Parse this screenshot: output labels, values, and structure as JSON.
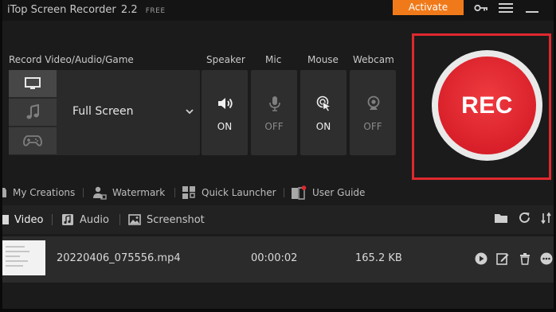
{
  "app": {
    "name": "iTop Screen Recorder",
    "version": "2.2",
    "edition": "FREE",
    "activate_label": "Activate",
    "accent_color": "#f07a1a",
    "rec_color": "#e0282e"
  },
  "record": {
    "section_label": "Record Video/Audio/Game",
    "sources": [
      {
        "name": "monitor-icon",
        "active": true
      },
      {
        "name": "music-note-icon",
        "active": false
      },
      {
        "name": "gamepad-icon",
        "active": false
      }
    ],
    "mode": "Full Screen"
  },
  "devices": [
    {
      "label": "Speaker",
      "state": "ON",
      "icon": "speaker-icon"
    },
    {
      "label": "Mic",
      "state": "OFF",
      "icon": "microphone-icon"
    },
    {
      "label": "Mouse",
      "state": "ON",
      "icon": "mouse-click-icon"
    },
    {
      "label": "Webcam",
      "state": "OFF",
      "icon": "webcam-icon"
    }
  ],
  "rec_button_label": "REC",
  "toolbar": {
    "my_creations": "My Creations",
    "watermark": "Watermark",
    "quick_launcher": "Quick Launcher",
    "user_guide": "User Guide"
  },
  "file_tabs": [
    {
      "label": "Video",
      "active": true
    },
    {
      "label": "Audio",
      "active": false
    },
    {
      "label": "Screenshot",
      "active": false
    }
  ],
  "files": [
    {
      "name": "20220406_075556.mp4",
      "duration": "00:00:02",
      "size": "165.2 KB"
    }
  ]
}
